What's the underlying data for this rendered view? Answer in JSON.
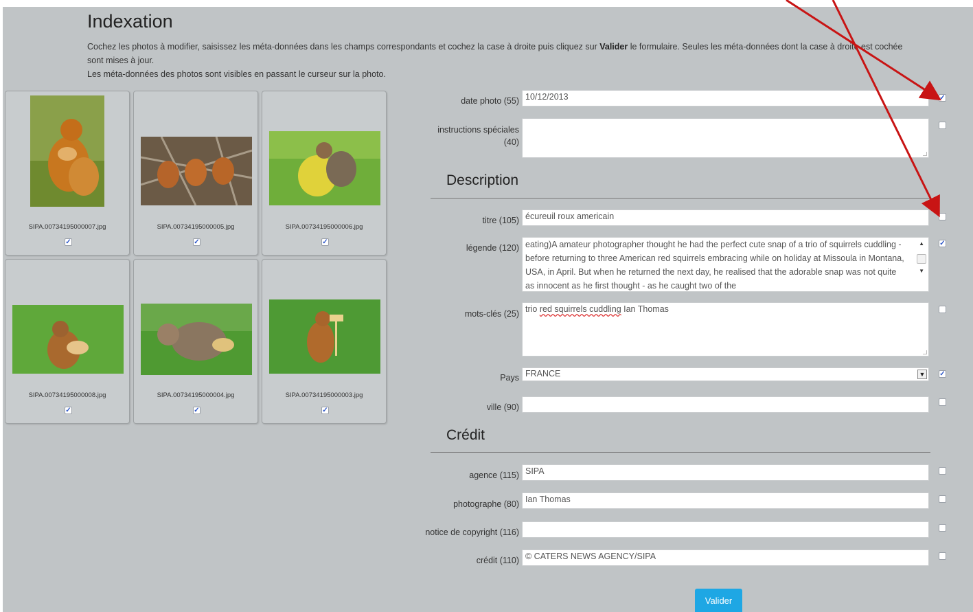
{
  "page": {
    "title": "Indexation",
    "intro_part1": "Cochez les photos à modifier, saisissez les méta-données dans les champs correspondants et cochez la case à droite puis cliquez sur ",
    "intro_bold": "Valider",
    "intro_part2": " le formulaire. Seules les méta-données dont la case à droite est cochée sont mises à jour.",
    "intro_line2": "Les méta-données des photos sont visibles en passant le curseur sur la photo."
  },
  "thumbnails": [
    {
      "filename": "SIPA.00734195000007.jpg",
      "checked": true
    },
    {
      "filename": "SIPA.00734195000005.jpg",
      "checked": true
    },
    {
      "filename": "SIPA.00734195000006.jpg",
      "checked": true
    },
    {
      "filename": "SIPA.00734195000008.jpg",
      "checked": true
    },
    {
      "filename": "SIPA.00734195000004.jpg",
      "checked": true
    },
    {
      "filename": "SIPA.00734195000003.jpg",
      "checked": true
    }
  ],
  "form": {
    "date_photo": {
      "label": "date photo (55)",
      "value": "10/12/2013",
      "checked": true
    },
    "instructions": {
      "label": "instructions spéciales (40)",
      "value": "",
      "checked": false
    },
    "description_heading": "Description",
    "titre": {
      "label": "titre (105)",
      "value": "écureuil roux americain",
      "checked": false
    },
    "legende": {
      "label": "légende (120)",
      "value": "eating)A amateur photographer thought he had the perfect cute snap of a trio of squirrels cuddling - before returning to three American red squirrels embracing while on holiday at Missoula in Montana, USA, in April. But when he returned the next day, he realised that the adorable snap was not quite as innocent as he first thought - as he caught two of the",
      "checked": true
    },
    "mots_cles": {
      "label": "mots-clés (25)",
      "value_plain1": "trio ",
      "value_squig1": "red squirrels cuddling",
      "value_plain2": " Ian Thomas",
      "checked": false
    },
    "pays": {
      "label": "Pays",
      "value": "FRANCE",
      "checked": true
    },
    "ville": {
      "label": "ville (90)",
      "value": "",
      "checked": false
    },
    "credit_heading": "Crédit",
    "agence": {
      "label": "agence (115)",
      "value": "SIPA",
      "checked": false
    },
    "photographe": {
      "label": "photographe (80)",
      "value": "Ian Thomas",
      "checked": false
    },
    "copyright": {
      "label": "notice de copyright (116)",
      "value": "",
      "checked": false
    },
    "credit": {
      "label": "crédit (110)",
      "value": "© CATERS NEWS AGENCY/SIPA",
      "checked": false
    }
  },
  "submit_label": "Valider",
  "colors": {
    "panel": "#c0c4c6",
    "button": "#1ea7e4",
    "annotation_arrow": "#c81414",
    "checkmark": "#2b55c8"
  }
}
